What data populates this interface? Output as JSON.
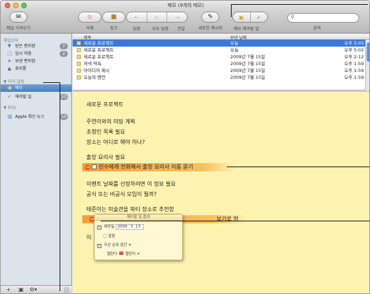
{
  "window": {
    "title": "메모 (9개의 메모)"
  },
  "toolbar": {
    "get_mail_label": "메일 가져오기",
    "delete_label": "삭제",
    "junk_label": "정크",
    "reply_label": "답장",
    "reply_all_label": "모두 답장",
    "forward_label": "전달",
    "new_message_label": "새로운 메시지",
    "note_todo_label": "메모 해야할 일",
    "search_label": "검색"
  },
  "sidebar": {
    "mailbox_header": "메일상자",
    "items": [
      {
        "label": "받은 편지함",
        "icon": "inbox-icon",
        "badge": "7"
      },
      {
        "label": "임시 저장",
        "icon": "drafts-icon",
        "badge": "2"
      },
      {
        "label": "보낸 편지함",
        "icon": "sent-icon",
        "badge": ""
      },
      {
        "label": "휴지통",
        "icon": "trash-icon",
        "badge": ""
      }
    ],
    "reminders_header": "▼ 미리 알림",
    "reminder_items": [
      {
        "label": "메모",
        "icon": "notes-icon",
        "badge": "",
        "selected": true
      },
      {
        "label": "해야할 일",
        "icon": "todo-icon",
        "badge": "10"
      }
    ],
    "rss_header": "▼ RSS",
    "rss_items": [
      {
        "label": "Apple 최신 뉴스",
        "icon": "rss-icon",
        "badge": "10"
      }
    ]
  },
  "list": {
    "headers": {
      "subject": "제목",
      "date": "보낸 날짜"
    },
    "rows": [
      {
        "subject": "새로운 프로젝트",
        "date": "오늘",
        "time": "오후 5:03",
        "selected": true
      },
      {
        "subject": "새로운 프로젝트",
        "date": "오늘",
        "time": "오후 5:02",
        "selected": false
      },
      {
        "subject": "새로운 프로젝트",
        "date": "2009년 7월 15일",
        "time": "오후 2:12",
        "selected": false
      },
      {
        "subject": "저녁 약속",
        "date": "2009년 7월 15일",
        "time": "오후 1:59",
        "selected": false
      },
      {
        "subject": "아이디어 제시",
        "date": "2009년 7월 15일",
        "time": "오후 1:59",
        "selected": false
      },
      {
        "subject": "오늘의 명언",
        "date": "2009년 7월 15일",
        "time": "오후 1:59",
        "selected": false
      }
    ]
  },
  "note": {
    "title": "새로운 프로젝트",
    "lines": [
      "주연이와의 미팅 계획",
      "초청인 목록 필요",
      "장소는 어디로 해야 하나?",
      "출장 요리사 필요",
      "이벤트 날짜를 선정하려면 이 정보 필요",
      "공식 또는 비공식 모임이 될까?",
      "태준이는 미술관을 파티 장소로 추천함"
    ],
    "todo_1": "민수에게 전화해서 출장 요리사 이름 묻기",
    "todo_2_tail": "보기로 함",
    "partial_line": "이"
  },
  "todo_popup": {
    "header": "해야할 일 옵션",
    "due_label": "예정일",
    "due_value": "2009 . 5 .13.",
    "alarm_label": "알람",
    "priority_label": "우선 순위",
    "priority_value": "중간 ≑",
    "calendar_label": "캘린더",
    "calendar_value": "캘린더 ≑"
  },
  "colors": {
    "selection_blue": "#3b78d8",
    "note_yellow": "#fdf3b0",
    "todo_highlight": "#f5a03a",
    "todo_icon": "#e85d1a"
  }
}
